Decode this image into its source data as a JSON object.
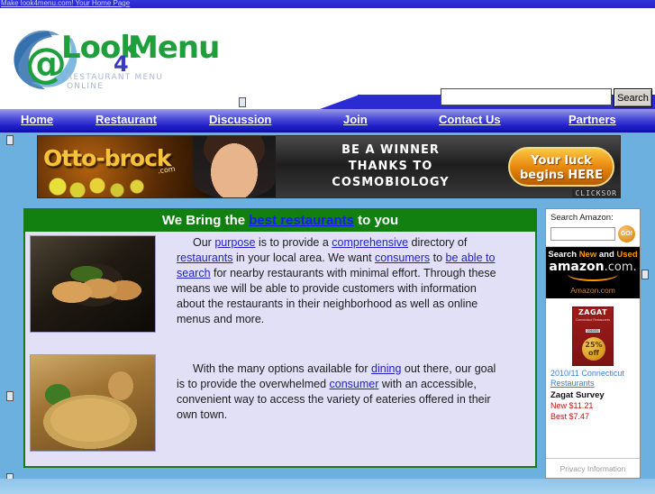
{
  "topbar": {
    "home_page_link": "Make look4menu.com! Your Home Page"
  },
  "logo": {
    "at": "@",
    "word1": "Look",
    "four": "4",
    "word2": "Menu",
    "tagline": "RESTAURANT MENU ONLINE"
  },
  "search": {
    "value": "",
    "placeholder": "",
    "button_label": "Search"
  },
  "nav": {
    "items": [
      {
        "label": "Home"
      },
      {
        "label": "Restaurant"
      },
      {
        "label": "Discussion"
      },
      {
        "label": "Join"
      },
      {
        "label": "Contact Us"
      },
      {
        "label": "Partners"
      }
    ]
  },
  "banner": {
    "brand": "Otto-brock",
    "brand_suffix": ".com",
    "headline_line1": "BE A WINNER",
    "headline_line2": "THANKS TO",
    "headline_line3": "COSMOBIOLOGY",
    "cta_line1": "Your luck",
    "cta_line2": "begins HERE",
    "network": "CLICKSOR"
  },
  "content": {
    "heading_before": "We Bring the ",
    "heading_link": "best restaurants",
    "heading_after": " to you",
    "paragraph1": {
      "t1": "Our ",
      "l1": "purpose",
      "t2": " is to provide a ",
      "l2": "comprehensive",
      "t3": " directory of ",
      "l3": "restaurants",
      "t4": " in your local area. We want ",
      "l4": "consumers",
      "t5": " to ",
      "l5": "be able to",
      "t6": " ",
      "l6": "search",
      "t7": " for nearby restaurants with minimal effort. Through these means we will be able to provide customers with information about the restaurants  in their neighborhood as well as online menus and more."
    },
    "paragraph2": {
      "t1": "With the many options available for ",
      "l1": "dining",
      "t2": " out there, our goal is to provide the overwhelmed ",
      "l2": "consumer",
      "t3": " with an accessible, convenient way to access the variety of eateries offered in their own town."
    },
    "photo1_alt": "seared-tuna-dish",
    "photo2_alt": "pasta-dish"
  },
  "sidebar": {
    "amazon_search_label": "Search Amazon:",
    "amazon_search_value": "",
    "amazon_go_label": "GO!",
    "amazon_tagline_plain1": "Search ",
    "amazon_tagline_new": "New",
    "amazon_tagline_plain2": " and ",
    "amazon_tagline_used": "Used",
    "amazon_wordmark": "amazon",
    "amazon_wordmark_suffix": ".com.",
    "amazon_domain": "Amazon.com",
    "zagat": {
      "cover_title": "ZAGAT",
      "cover_sub": "Connecticut Restaurants",
      "cover_year": "2010/11",
      "badge_line1": "25%",
      "badge_line2": "off",
      "title_line1": "2010/11 Connecticut",
      "title_link": "Restaurants",
      "survey": "Zagat Survey",
      "new_price": "New $11.21",
      "best_price": "Best $7.47"
    },
    "privacy": "Privacy Information"
  },
  "colors": {
    "page_background": "#6cb0e0",
    "nav_blue": "#2020c8",
    "header_green": "#118011",
    "content_lavender": "#e2e0f7",
    "link_blue": "#2020c8",
    "amazon_orange": "#ff9900",
    "price_red": "#c01414"
  }
}
